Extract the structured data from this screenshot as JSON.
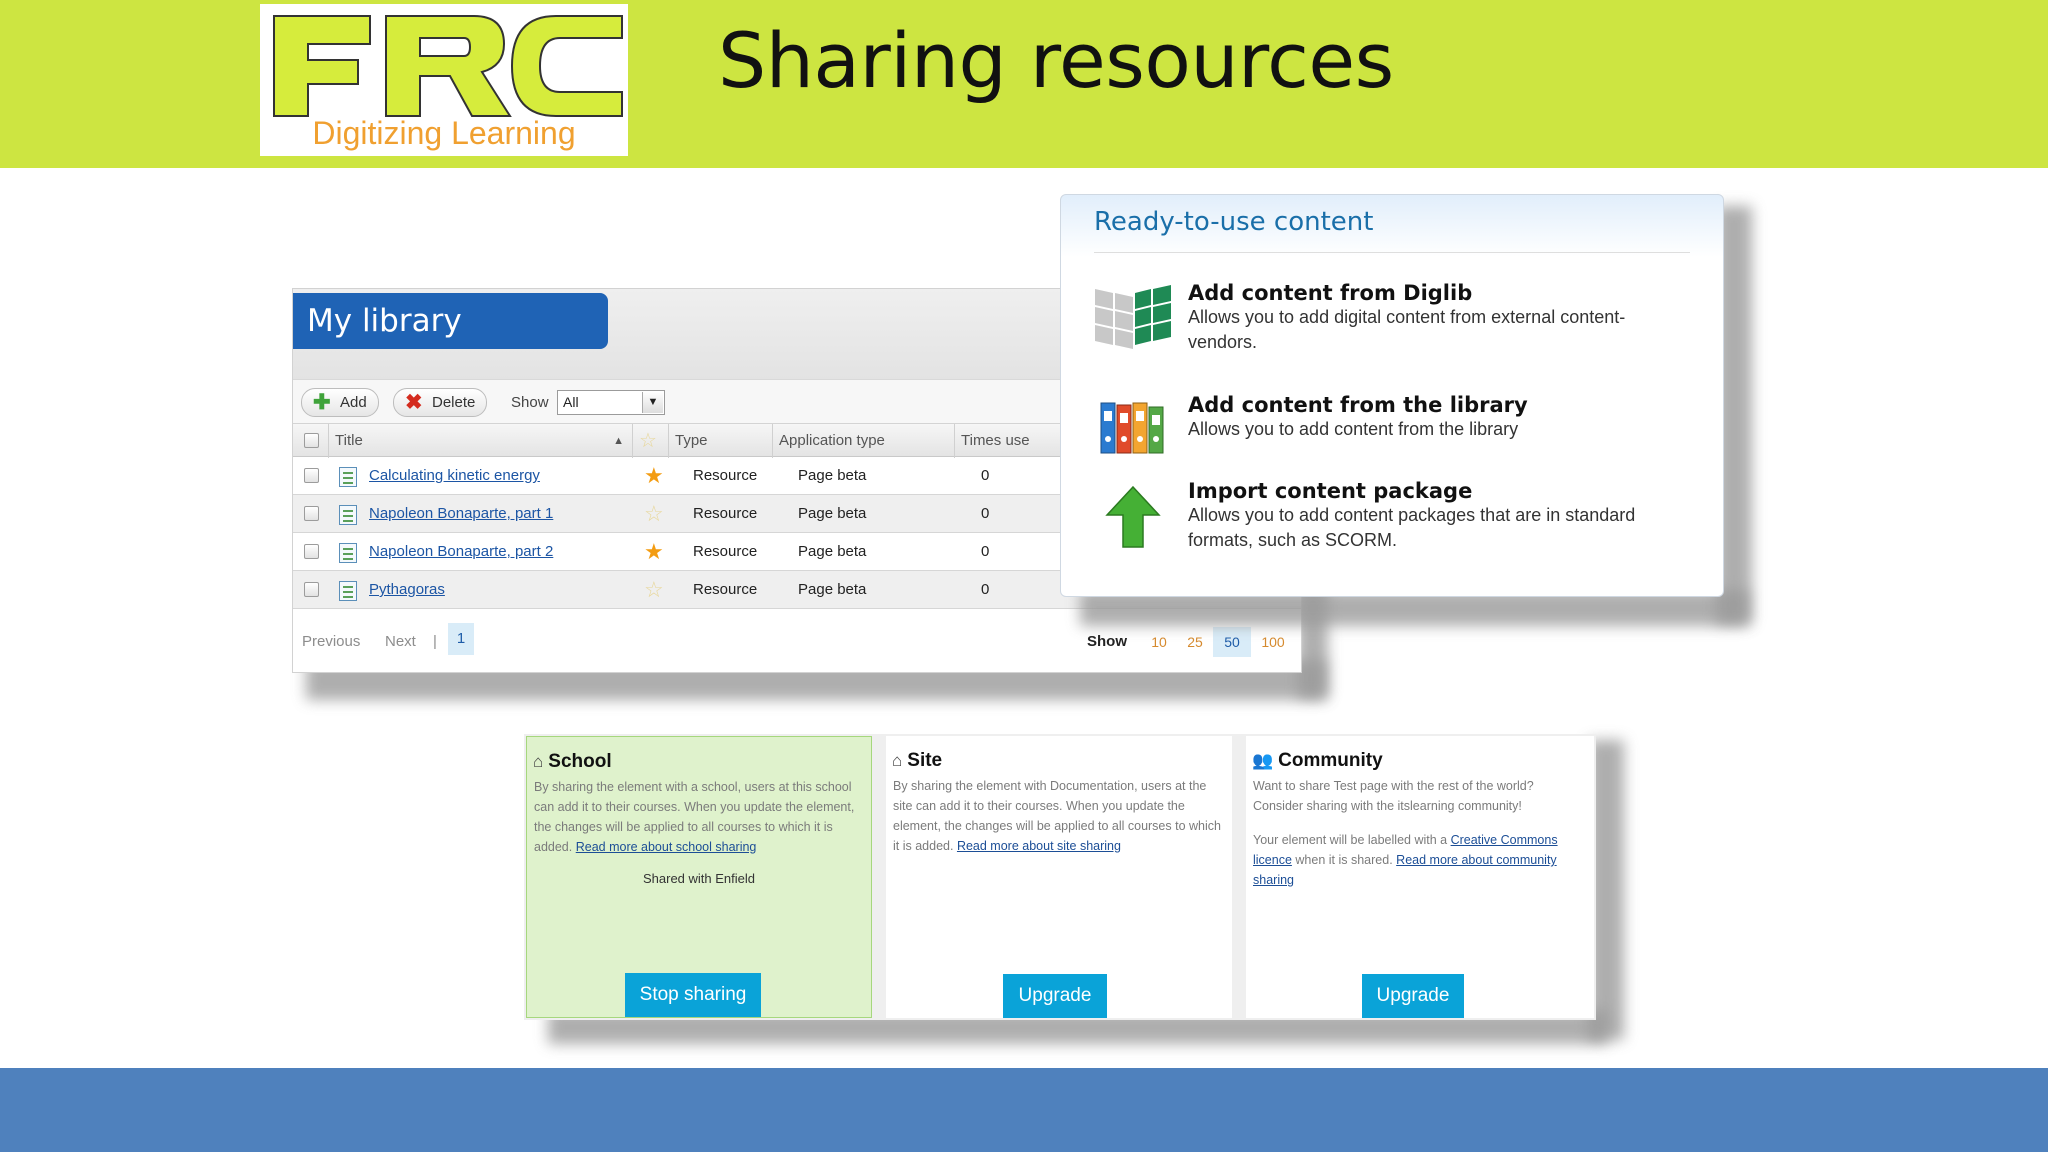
{
  "slide": {
    "title": "Sharing resources",
    "colors": {
      "top_band": "#cde541",
      "bottom_band": "#4f81bd"
    }
  },
  "logo": {
    "wordmark": "FRC",
    "tagline": "Digitizing Learning"
  },
  "library": {
    "heading": "My library",
    "toolbar": {
      "add_label": "Add",
      "delete_label": "Delete",
      "show_label": "Show",
      "show_value": "All"
    },
    "columns": [
      "Title",
      "Type",
      "Application type",
      "Times use"
    ],
    "rows": [
      {
        "title": "Calculating kinetic energy",
        "favorite": true,
        "type": "Resource",
        "app_type": "Page beta",
        "times_used": "0"
      },
      {
        "title": "Napoleon Bonaparte, part 1",
        "favorite": false,
        "type": "Resource",
        "app_type": "Page beta",
        "times_used": "0"
      },
      {
        "title": "Napoleon Bonaparte, part 2",
        "favorite": true,
        "type": "Resource",
        "app_type": "Page beta",
        "times_used": "0"
      },
      {
        "title": "Pythagoras",
        "favorite": false,
        "type": "Resource",
        "app_type": "Page beta",
        "times_used": "0"
      }
    ],
    "pager": {
      "previous": "Previous",
      "next": "Next",
      "separator": "|",
      "current_page": "1",
      "show_label": "Show",
      "sizes": [
        "10",
        "25",
        "50",
        "100"
      ],
      "selected_size": "50"
    }
  },
  "ready": {
    "heading": "Ready-to-use content",
    "items": [
      {
        "icon": "grid-icon",
        "title": "Add content from Diglib",
        "desc": "Allows you to add digital content from external content-vendors."
      },
      {
        "icon": "binders-icon",
        "title": "Add content from the library",
        "desc": "Allows you to add content from the library"
      },
      {
        "icon": "upload-arrow-icon",
        "title": "Import content package",
        "desc": "Allows you to add content packages that are in standard formats, such as SCORM."
      }
    ]
  },
  "sharing": {
    "school": {
      "title": "School",
      "body": "By sharing the element with a school, users at this school can add it to their courses. When you update the element, the changes will be applied to all courses to which it is added.",
      "link": "Read more about school sharing",
      "status": "Shared with Enfield",
      "button": "Stop sharing"
    },
    "site": {
      "title": "Site",
      "body": "By sharing the element with Documentation, users at the site can add it to their courses. When you update the element, the changes will be applied to all courses to which it is added.",
      "link": "Read more about site sharing",
      "button": "Upgrade"
    },
    "community": {
      "title": "Community",
      "body": "Want to share Test page with the rest of the world? Consider sharing with the itslearning community!",
      "licence_prefix": "Your element will be labelled with a",
      "licence_link": "Creative Commons licence",
      "licence_suffix": "when it is shared.",
      "link": "Read more about community sharing",
      "button": "Upgrade"
    }
  }
}
